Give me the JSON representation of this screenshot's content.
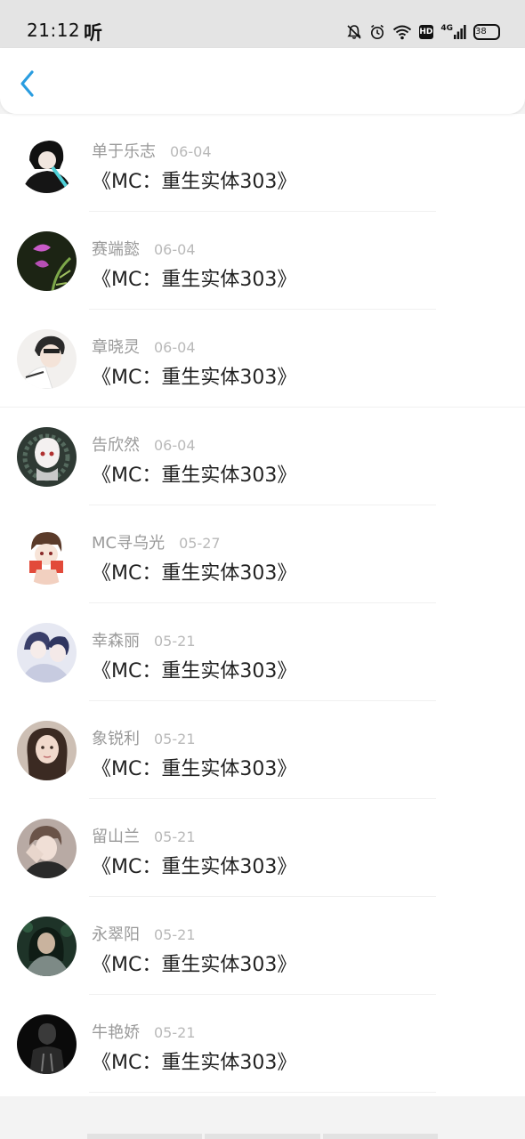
{
  "status_bar": {
    "time": "21:12",
    "extra": "听",
    "battery": "38",
    "network": "4G",
    "hd": "HD",
    "icons": [
      "mute-bell-icon",
      "alarm-icon",
      "wifi-icon",
      "hd-icon",
      "signal-icon",
      "battery-icon"
    ]
  },
  "nav": {
    "back_icon": "chevron-left-icon",
    "accent_color": "#2a9de0"
  },
  "comments": [
    {
      "user": "单于乐志",
      "date": "06-04",
      "text": "《MC：重生实体303》"
    },
    {
      "user": "赛端懿",
      "date": "06-04",
      "text": "《MC：重生实体303》"
    },
    {
      "user": "章晓灵",
      "date": "06-04",
      "text": "《MC：重生实体303》"
    },
    {
      "user": "告欣然",
      "date": "06-04",
      "text": "《MC：重生实体303》"
    },
    {
      "user": "MC寻乌光",
      "date": "05-27",
      "text": "《MC：重生实体303》"
    },
    {
      "user": "幸森丽",
      "date": "05-21",
      "text": "《MC：重生实体303》"
    },
    {
      "user": "象锐利",
      "date": "05-21",
      "text": "《MC：重生实体303》"
    },
    {
      "user": "留山兰",
      "date": "05-21",
      "text": "《MC：重生实体303》"
    },
    {
      "user": "永翠阳",
      "date": "05-21",
      "text": "《MC：重生实体303》"
    },
    {
      "user": "牛艳娇",
      "date": "05-21",
      "text": "《MC：重生实体303》"
    }
  ]
}
